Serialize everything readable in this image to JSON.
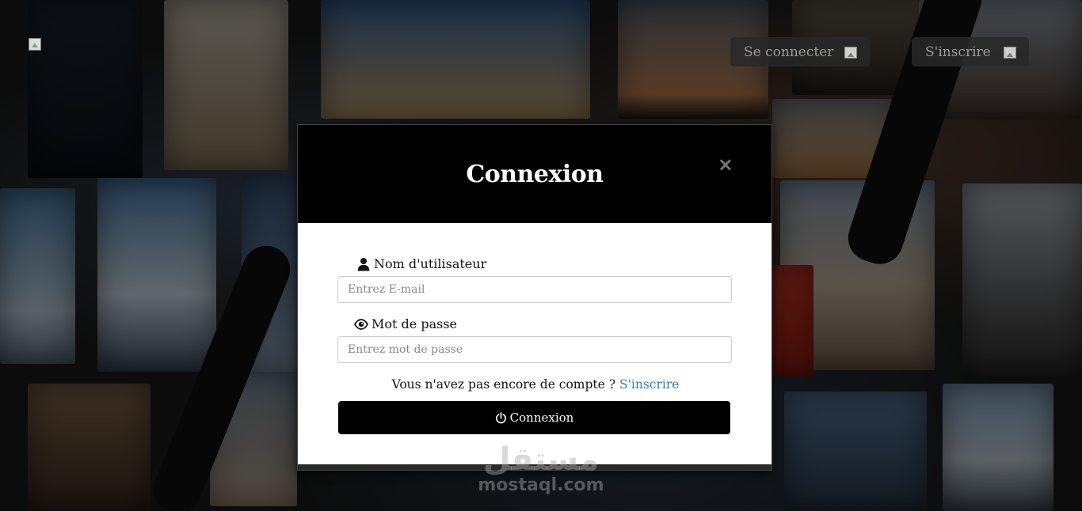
{
  "header": {
    "login_label": "Se connecter",
    "register_label": "S'inscrire"
  },
  "modal": {
    "title": "Connexion",
    "close_glyph": "×",
    "username_label": "Nom d'utilisateur",
    "username_placeholder": "Entrez E-mail",
    "password_label": "Mot de passe",
    "password_placeholder": "Entrez mot de passe",
    "no_account_text": "Vous n'avez pas encore de compte ?",
    "signup_link": "S'inscrire",
    "submit_label": "Connexion"
  },
  "watermark": {
    "arabic": "مستقل",
    "latin": "mostaql.com"
  },
  "icons": {
    "user": "user-icon",
    "eye": "eye-icon",
    "power": "power-icon",
    "close": "close-icon",
    "image": "broken-image-icon"
  }
}
